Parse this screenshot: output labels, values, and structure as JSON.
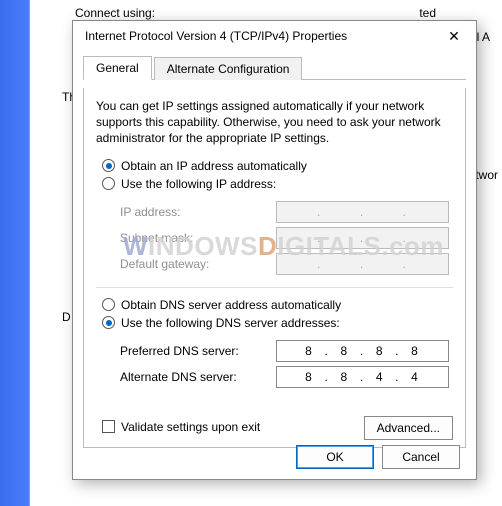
{
  "background": {
    "connect_using": "Connect using:",
    "right_snip_1": "ted",
    "right_snip_2": "al A",
    "right_snip_3": "twor",
    "th_label": "Th",
    "d_label": "D"
  },
  "watermark": {
    "part1_prefix": "W",
    "part1": "INDOWS",
    "part2_prefix": "D",
    "part2": "IGITALS",
    "suffix": ".com"
  },
  "dialog": {
    "title": "Internet Protocol Version 4 (TCP/IPv4) Properties",
    "close_glyph": "✕",
    "tabs": {
      "general": "General",
      "alternate": "Alternate Configuration"
    },
    "description": "You can get IP settings assigned automatically if your network supports this capability. Otherwise, you need to ask your network administrator for the appropriate IP settings.",
    "ip_section": {
      "auto_label": "Obtain an IP address automatically",
      "manual_label": "Use the following IP address:",
      "ip_address_label": "IP address:",
      "subnet_label": "Subnet mask:",
      "gateway_label": "Default gateway:",
      "ip_address_value": ".       .       .",
      "subnet_value": ".       .       .",
      "gateway_value": ".       .       ."
    },
    "dns_section": {
      "auto_label": "Obtain DNS server address automatically",
      "manual_label": "Use the following DNS server addresses:",
      "preferred_label": "Preferred DNS server:",
      "alternate_label": "Alternate DNS server:",
      "preferred_value": "8  .  8  .  8  .  8",
      "alternate_value": "8  .  8  .  4  .  4"
    },
    "validate_label": "Validate settings upon exit",
    "advanced_label": "Advanced...",
    "ok_label": "OK",
    "cancel_label": "Cancel"
  }
}
